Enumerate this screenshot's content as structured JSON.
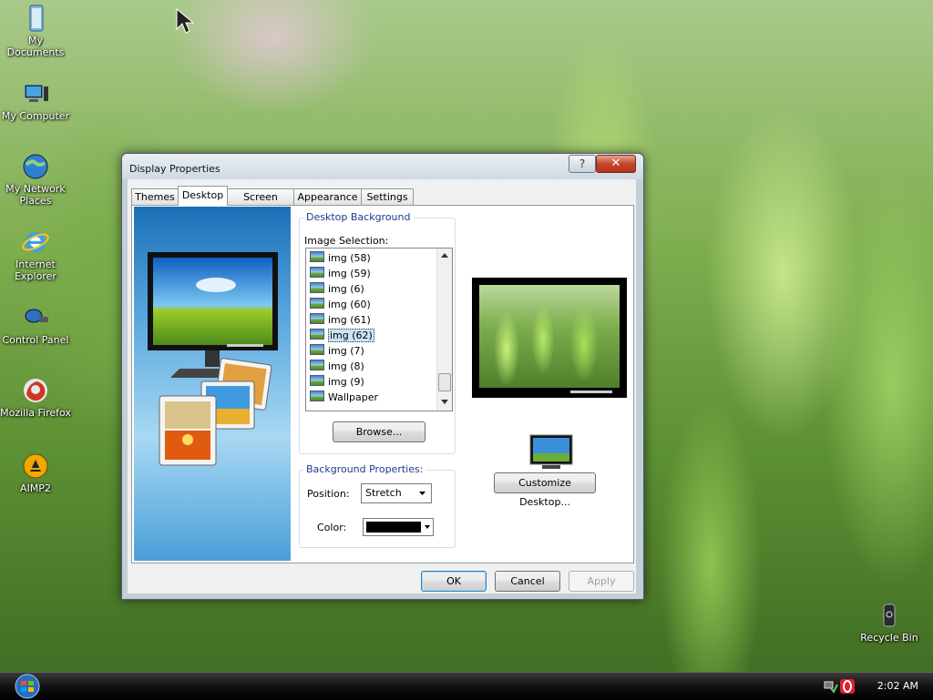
{
  "desktop": {
    "icons": [
      {
        "label": "My Documents",
        "icon": "folder-documents-icon"
      },
      {
        "label": "My Computer",
        "icon": "computer-icon"
      },
      {
        "label": "My Network Places",
        "icon": "network-globe-icon"
      },
      {
        "label": "Internet Explorer",
        "icon": "internet-explorer-icon"
      },
      {
        "label": "Control Panel",
        "icon": "control-panel-icon"
      },
      {
        "label": "Mozilla Firefox",
        "icon": "firefox-icon"
      },
      {
        "label": "AIMP2",
        "icon": "aimp-icon"
      }
    ],
    "recycle_bin": "Recycle Bin"
  },
  "taskbar": {
    "clock": "2:02 AM"
  },
  "dialog": {
    "title": "Display Properties",
    "help_glyph": "?",
    "close_glyph": "✕",
    "tabs": [
      "Themes",
      "Desktop",
      "Screen Saver",
      "Appearance",
      "Settings"
    ],
    "active_tab": "Desktop",
    "desktop_background": {
      "group_label": "Desktop Background",
      "image_selection_label": "Image Selection:",
      "items": [
        "img (58)",
        "img (59)",
        "img (6)",
        "img (60)",
        "img (61)",
        "img (62)",
        "img (7)",
        "img (8)",
        "img (9)",
        "Wallpaper"
      ],
      "selected": "img (62)",
      "browse_label": "Browse..."
    },
    "background_properties": {
      "group_label": "Background Properties:",
      "position_label": "Position:",
      "position_value": "Stretch",
      "color_label": "Color:",
      "color_value": "#000000"
    },
    "customize_label": "Customize Desktop...",
    "buttons": {
      "ok": "OK",
      "cancel": "Cancel",
      "apply": "Apply"
    }
  }
}
